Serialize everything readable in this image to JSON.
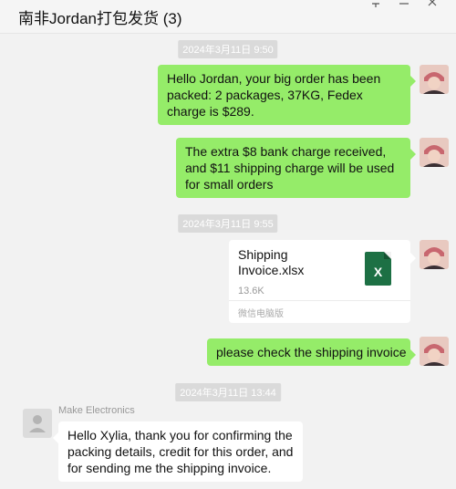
{
  "header": {
    "title": "南非Jordan打包发货 (3)",
    "icons": [
      "pin-icon",
      "minimize-icon",
      "close-icon"
    ]
  },
  "messages": [
    {
      "type": "timestamp",
      "text": "2024年3月11日 9:50"
    },
    {
      "type": "text",
      "sender": "me",
      "text": "Hello Jordan, your big order has been packed: 2 packages, 37KG, Fedex charge is $289."
    },
    {
      "type": "text",
      "sender": "me",
      "text": "The extra $8 bank charge received, and $11 shipping  charge will be used for small orders"
    },
    {
      "type": "timestamp",
      "text": "2024年3月11日 9:55"
    },
    {
      "type": "file",
      "sender": "me",
      "file_name": "Shipping Invoice.xlsx",
      "file_size": "13.6K",
      "file_icon_letter": "X",
      "footer": "微信电脑版"
    },
    {
      "type": "text",
      "sender": "me",
      "text": "please check the shipping invoice"
    },
    {
      "type": "timestamp",
      "text": "2024年3月11日 13:44"
    },
    {
      "type": "text",
      "sender": "them",
      "sender_name": "Make Electronics",
      "text": "Hello Xylia, thank you for confirming the packing details, credit for this order, and for sending me the shipping invoice."
    }
  ],
  "colors": {
    "my_bubble": "#95ec69",
    "their_bubble": "#ffffff",
    "background": "#f2f2f2",
    "excel_green": "#1d7044"
  }
}
